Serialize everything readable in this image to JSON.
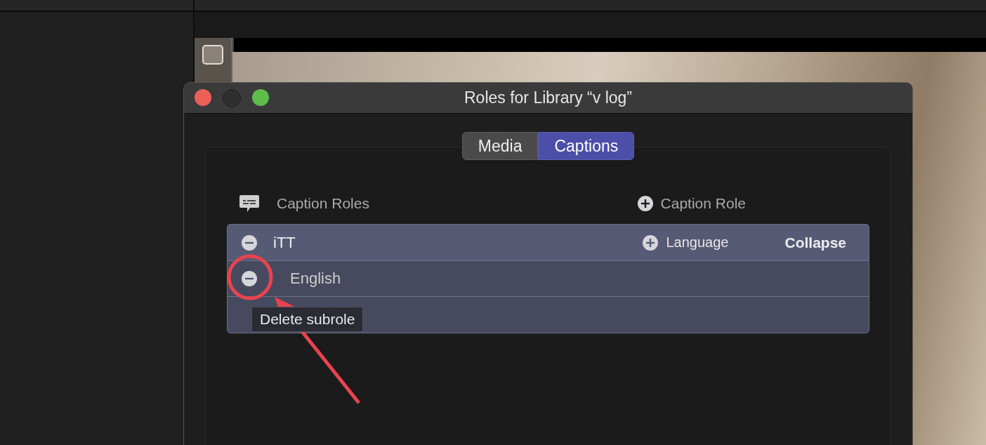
{
  "window": {
    "title": "Roles for Library “v log”"
  },
  "window_controls": [
    {
      "kind": "close",
      "disabled": false
    },
    {
      "kind": "minimize",
      "disabled": true
    },
    {
      "kind": "zoom",
      "disabled": false
    }
  ],
  "tabs": [
    {
      "label": "Media",
      "selected": false
    },
    {
      "label": "Captions",
      "selected": true
    }
  ],
  "section": {
    "title": "Caption Roles",
    "add_button": "Caption Role"
  },
  "roles": [
    {
      "name": "iTT",
      "add_button": "Language",
      "toggle": "Collapse",
      "expanded": true,
      "subroles": [
        {
          "name": "English",
          "highlighted": true
        }
      ]
    }
  ],
  "tooltip": "Delete subrole"
}
